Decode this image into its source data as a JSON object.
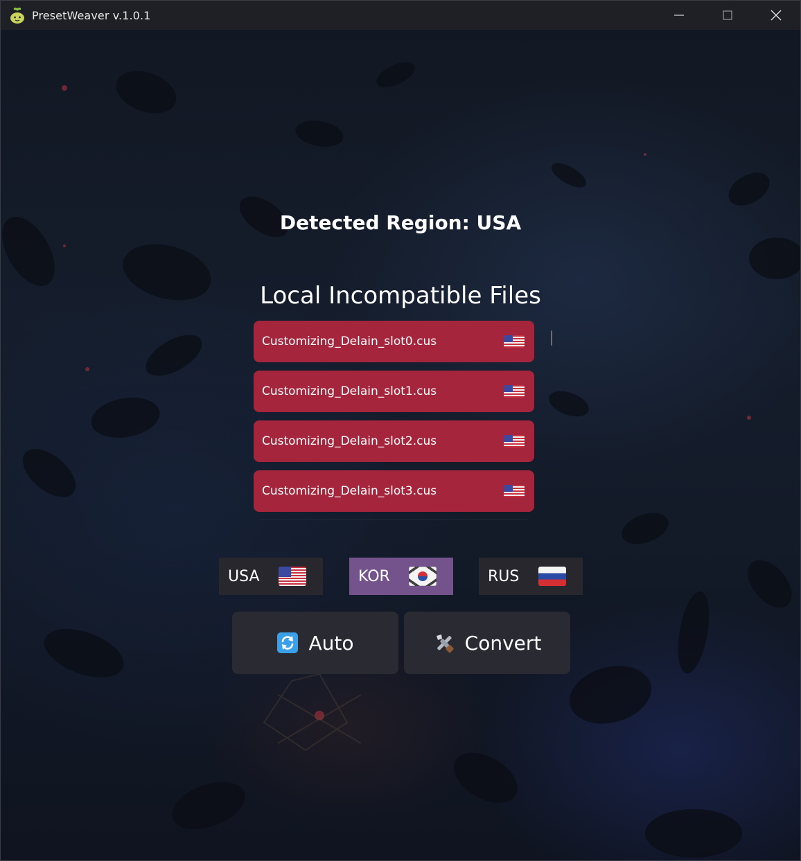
{
  "window": {
    "title": "PresetWeaver v.1.0.1",
    "app_icon": "sprout-face-icon",
    "controls": [
      "minimize-icon",
      "maximize-icon",
      "close-icon"
    ]
  },
  "main": {
    "detected_region_text": "Detected Region: USA",
    "files_title": "Local Incompatible Files",
    "files": [
      {
        "name": "Customizing_Delain_slot0.cus",
        "flag": "us-flag-icon"
      },
      {
        "name": "Customizing_Delain_slot1.cus",
        "flag": "us-flag-icon"
      },
      {
        "name": "Customizing_Delain_slot2.cus",
        "flag": "us-flag-icon"
      },
      {
        "name": "Customizing_Delain_slot3.cus",
        "flag": "us-flag-icon"
      }
    ],
    "regions": [
      {
        "label": "USA",
        "flag": "us-flag-icon",
        "selected": false
      },
      {
        "label": "KOR",
        "flag": "kr-flag-icon",
        "selected": true
      },
      {
        "label": "RUS",
        "flag": "ru-flag-icon",
        "selected": false
      }
    ],
    "actions": {
      "auto_label": "Auto",
      "auto_icon": "refresh-icon",
      "convert_label": "Convert",
      "convert_icon": "tools-icon"
    }
  },
  "colors": {
    "file_item_bg": "#a5263c",
    "selected_region_bg": "#74528c",
    "button_bg": "#2a2a33",
    "titlebar_bg": "#1f2025"
  }
}
